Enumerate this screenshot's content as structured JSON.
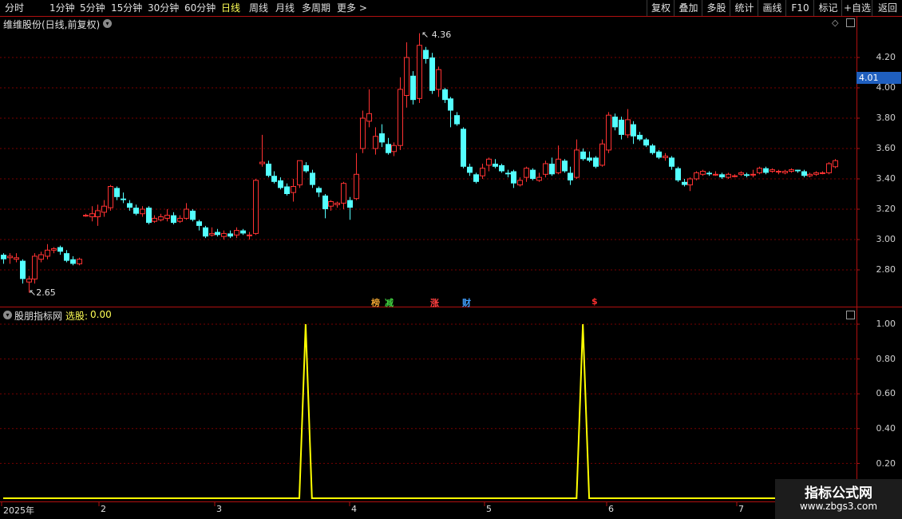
{
  "toolbar": {
    "periods": [
      "分时",
      "1分钟",
      "5分钟",
      "15分钟",
      "30分钟",
      "60分钟",
      "日线",
      "周线",
      "月线",
      "多周期",
      "更多 >"
    ],
    "active_period": "日线",
    "actions": [
      "复权",
      "叠加",
      "多股",
      "统计",
      "画线",
      "F10",
      "标记",
      "+自选",
      "返回"
    ]
  },
  "main_panel": {
    "title": "维维股份(日线,前复权)",
    "current_price": "4.01",
    "high_marker": "4.36",
    "low_marker": "2.65",
    "y_ticks": [
      "4.20",
      "4.00",
      "3.80",
      "3.60",
      "3.40",
      "3.20",
      "3.00",
      "2.80"
    ],
    "tags": [
      {
        "text": "榜",
        "color": "#e8a030"
      },
      {
        "text": "减",
        "color": "#40d040"
      },
      {
        "text": "涨",
        "color": "#ff4040"
      },
      {
        "text": "财",
        "color": "#40a0ff"
      },
      {
        "text": "$",
        "color": "#ff3030"
      }
    ],
    "colors": {
      "up": "#ff3232",
      "down": "#54ffff",
      "grid": "#8b0000"
    }
  },
  "indicator_panel": {
    "title": "股朋指标网",
    "value_label": "选股:",
    "value": "0.00",
    "y_ticks": [
      "1.00",
      "0.80",
      "0.60",
      "0.40",
      "0.20"
    ],
    "line_color": "#ffff00"
  },
  "x_axis": {
    "labels": [
      "2025年",
      "2",
      "3",
      "4",
      "5",
      "6",
      "7"
    ]
  },
  "watermark": {
    "title": "指标公式网",
    "url": "www.zbgs3.com"
  },
  "chart_data": {
    "type": "candlestick",
    "series": [
      {
        "o": 2.9,
        "c": 2.87,
        "h": 2.91,
        "l": 2.84
      },
      {
        "o": 2.88,
        "c": 2.89,
        "h": 2.91,
        "l": 2.84
      },
      {
        "o": 2.87,
        "c": 2.88,
        "h": 2.91,
        "l": 2.85
      },
      {
        "o": 2.86,
        "c": 2.74,
        "h": 2.87,
        "l": 2.71
      },
      {
        "o": 2.72,
        "c": 2.74,
        "h": 2.76,
        "l": 2.65
      },
      {
        "o": 2.74,
        "c": 2.89,
        "h": 2.91,
        "l": 2.71
      },
      {
        "o": 2.87,
        "c": 2.9,
        "h": 2.92,
        "l": 2.85
      },
      {
        "o": 2.89,
        "c": 2.93,
        "h": 2.97,
        "l": 2.87
      },
      {
        "o": 2.93,
        "c": 2.94,
        "h": 2.95,
        "l": 2.91
      },
      {
        "o": 2.95,
        "c": 2.92,
        "h": 2.96,
        "l": 2.9
      },
      {
        "o": 2.91,
        "c": 2.86,
        "h": 2.93,
        "l": 2.85
      },
      {
        "o": 2.87,
        "c": 2.84,
        "h": 2.89,
        "l": 2.83
      },
      {
        "o": 2.84,
        "c": 2.87,
        "h": 2.88,
        "l": 2.83
      },
      {
        "o": 3.16,
        "c": 3.16,
        "h": 3.17,
        "l": 3.15
      },
      {
        "o": 3.15,
        "c": 3.17,
        "h": 3.22,
        "l": 3.12
      },
      {
        "o": 3.15,
        "c": 3.19,
        "h": 3.23,
        "l": 3.09
      },
      {
        "o": 3.18,
        "c": 3.22,
        "h": 3.26,
        "l": 3.15
      },
      {
        "o": 3.21,
        "c": 3.35,
        "h": 3.36,
        "l": 3.19
      },
      {
        "o": 3.34,
        "c": 3.28,
        "h": 3.35,
        "l": 3.26
      },
      {
        "o": 3.27,
        "c": 3.26,
        "h": 3.31,
        "l": 3.24
      },
      {
        "o": 3.24,
        "c": 3.21,
        "h": 3.26,
        "l": 3.19
      },
      {
        "o": 3.21,
        "c": 3.17,
        "h": 3.23,
        "l": 3.16
      },
      {
        "o": 3.17,
        "c": 3.2,
        "h": 3.22,
        "l": 3.15
      },
      {
        "o": 3.21,
        "c": 3.11,
        "h": 3.22,
        "l": 3.1
      },
      {
        "o": 3.12,
        "c": 3.14,
        "h": 3.16,
        "l": 3.11
      },
      {
        "o": 3.13,
        "c": 3.15,
        "h": 3.17,
        "l": 3.12
      },
      {
        "o": 3.14,
        "c": 3.16,
        "h": 3.2,
        "l": 3.12
      },
      {
        "o": 3.16,
        "c": 3.11,
        "h": 3.18,
        "l": 3.1
      },
      {
        "o": 3.12,
        "c": 3.14,
        "h": 3.16,
        "l": 3.11
      },
      {
        "o": 3.14,
        "c": 3.2,
        "h": 3.24,
        "l": 3.13
      },
      {
        "o": 3.19,
        "c": 3.13,
        "h": 3.2,
        "l": 3.12
      },
      {
        "o": 3.12,
        "c": 3.09,
        "h": 3.13,
        "l": 3.06
      },
      {
        "o": 3.08,
        "c": 3.02,
        "h": 3.09,
        "l": 3.01
      },
      {
        "o": 3.03,
        "c": 3.04,
        "h": 3.08,
        "l": 3.02
      },
      {
        "o": 3.05,
        "c": 3.03,
        "h": 3.07,
        "l": 3.02
      },
      {
        "o": 3.02,
        "c": 3.04,
        "h": 3.06,
        "l": 3.0
      },
      {
        "o": 3.04,
        "c": 3.02,
        "h": 3.06,
        "l": 3.01
      },
      {
        "o": 3.03,
        "c": 3.06,
        "h": 3.08,
        "l": 3.01
      },
      {
        "o": 3.06,
        "c": 3.04,
        "h": 3.07,
        "l": 3.03
      },
      {
        "o": 3.03,
        "c": 3.03,
        "h": 3.05,
        "l": 3.0
      },
      {
        "o": 3.04,
        "c": 3.39,
        "h": 3.4,
        "l": 3.03
      },
      {
        "o": 3.5,
        "c": 3.51,
        "h": 3.69,
        "l": 3.48
      },
      {
        "o": 3.5,
        "c": 3.42,
        "h": 3.52,
        "l": 3.41
      },
      {
        "o": 3.42,
        "c": 3.38,
        "h": 3.45,
        "l": 3.37
      },
      {
        "o": 3.39,
        "c": 3.34,
        "h": 3.41,
        "l": 3.33
      },
      {
        "o": 3.35,
        "c": 3.3,
        "h": 3.37,
        "l": 3.29
      },
      {
        "o": 3.31,
        "c": 3.35,
        "h": 3.4,
        "l": 3.25
      },
      {
        "o": 3.36,
        "c": 3.52,
        "h": 3.52,
        "l": 3.34
      },
      {
        "o": 3.49,
        "c": 3.45,
        "h": 3.51,
        "l": 3.44
      },
      {
        "o": 3.44,
        "c": 3.36,
        "h": 3.46,
        "l": 3.34
      },
      {
        "o": 3.34,
        "c": 3.31,
        "h": 3.35,
        "l": 3.28
      },
      {
        "o": 3.29,
        "c": 3.2,
        "h": 3.3,
        "l": 3.14
      },
      {
        "o": 3.22,
        "c": 3.25,
        "h": 3.26,
        "l": 3.19
      },
      {
        "o": 3.23,
        "c": 3.24,
        "h": 3.25,
        "l": 3.21
      },
      {
        "o": 3.24,
        "c": 3.37,
        "h": 3.38,
        "l": 3.2
      },
      {
        "o": 3.26,
        "c": 3.21,
        "h": 3.28,
        "l": 3.13
      },
      {
        "o": 3.27,
        "c": 3.43,
        "h": 3.57,
        "l": 3.26
      },
      {
        "o": 3.6,
        "c": 3.8,
        "h": 3.85,
        "l": 3.57
      },
      {
        "o": 3.78,
        "c": 3.83,
        "h": 3.99,
        "l": 3.74
      },
      {
        "o": 3.6,
        "c": 3.68,
        "h": 3.74,
        "l": 3.56
      },
      {
        "o": 3.7,
        "c": 3.64,
        "h": 3.76,
        "l": 3.61
      },
      {
        "o": 3.63,
        "c": 3.57,
        "h": 3.67,
        "l": 3.56
      },
      {
        "o": 3.58,
        "c": 3.62,
        "h": 3.64,
        "l": 3.55
      },
      {
        "o": 3.62,
        "c": 3.99,
        "h": 4.07,
        "l": 3.59
      },
      {
        "o": 3.95,
        "c": 4.2,
        "h": 4.3,
        "l": 3.87
      },
      {
        "o": 4.08,
        "c": 3.92,
        "h": 4.11,
        "l": 3.89
      },
      {
        "o": 3.93,
        "c": 4.28,
        "h": 4.36,
        "l": 3.9
      },
      {
        "o": 4.25,
        "c": 4.19,
        "h": 4.27,
        "l": 4.16
      },
      {
        "o": 4.2,
        "c": 3.98,
        "h": 4.23,
        "l": 3.96
      },
      {
        "o": 3.99,
        "c": 4.12,
        "h": 4.14,
        "l": 3.94
      },
      {
        "o": 3.99,
        "c": 3.92,
        "h": 4.0,
        "l": 3.9
      },
      {
        "o": 3.93,
        "c": 3.85,
        "h": 3.94,
        "l": 3.74
      },
      {
        "o": 3.82,
        "c": 3.76,
        "h": 3.84,
        "l": 3.75
      },
      {
        "o": 3.73,
        "c": 3.48,
        "h": 3.74,
        "l": 3.47
      },
      {
        "o": 3.48,
        "c": 3.44,
        "h": 3.5,
        "l": 3.42
      },
      {
        "o": 3.43,
        "c": 3.38,
        "h": 3.44,
        "l": 3.37
      },
      {
        "o": 3.42,
        "c": 3.47,
        "h": 3.5,
        "l": 3.4
      },
      {
        "o": 3.49,
        "c": 3.53,
        "h": 3.54,
        "l": 3.45
      },
      {
        "o": 3.5,
        "c": 3.48,
        "h": 3.53,
        "l": 3.47
      },
      {
        "o": 3.49,
        "c": 3.45,
        "h": 3.5,
        "l": 3.44
      },
      {
        "o": 3.44,
        "c": 3.43,
        "h": 3.46,
        "l": 3.41
      },
      {
        "o": 3.45,
        "c": 3.37,
        "h": 3.46,
        "l": 3.34
      },
      {
        "o": 3.36,
        "c": 3.39,
        "h": 3.41,
        "l": 3.35
      },
      {
        "o": 3.41,
        "c": 3.47,
        "h": 3.48,
        "l": 3.38
      },
      {
        "o": 3.46,
        "c": 3.4,
        "h": 3.47,
        "l": 3.39
      },
      {
        "o": 3.39,
        "c": 3.41,
        "h": 3.44,
        "l": 3.38
      },
      {
        "o": 3.43,
        "c": 3.5,
        "h": 3.52,
        "l": 3.41
      },
      {
        "o": 3.5,
        "c": 3.43,
        "h": 3.54,
        "l": 3.42
      },
      {
        "o": 3.44,
        "c": 3.53,
        "h": 3.62,
        "l": 3.43
      },
      {
        "o": 3.52,
        "c": 3.45,
        "h": 3.53,
        "l": 3.44
      },
      {
        "o": 3.44,
        "c": 3.39,
        "h": 3.48,
        "l": 3.36
      },
      {
        "o": 3.41,
        "c": 3.59,
        "h": 3.66,
        "l": 3.4
      },
      {
        "o": 3.58,
        "c": 3.53,
        "h": 3.6,
        "l": 3.52
      },
      {
        "o": 3.54,
        "c": 3.52,
        "h": 3.58,
        "l": 3.51
      },
      {
        "o": 3.54,
        "c": 3.48,
        "h": 3.55,
        "l": 3.47
      },
      {
        "o": 3.49,
        "c": 3.63,
        "h": 3.66,
        "l": 3.48
      },
      {
        "o": 3.59,
        "c": 3.82,
        "h": 3.84,
        "l": 3.57
      },
      {
        "o": 3.81,
        "c": 3.74,
        "h": 3.83,
        "l": 3.72
      },
      {
        "o": 3.79,
        "c": 3.69,
        "h": 3.81,
        "l": 3.66
      },
      {
        "o": 3.69,
        "c": 3.79,
        "h": 3.86,
        "l": 3.67
      },
      {
        "o": 3.76,
        "c": 3.68,
        "h": 3.78,
        "l": 3.63
      },
      {
        "o": 3.69,
        "c": 3.66,
        "h": 3.71,
        "l": 3.65
      },
      {
        "o": 3.66,
        "c": 3.62,
        "h": 3.67,
        "l": 3.61
      },
      {
        "o": 3.62,
        "c": 3.57,
        "h": 3.63,
        "l": 3.56
      },
      {
        "o": 3.58,
        "c": 3.54,
        "h": 3.59,
        "l": 3.53
      },
      {
        "o": 3.54,
        "c": 3.55,
        "h": 3.57,
        "l": 3.52
      },
      {
        "o": 3.54,
        "c": 3.48,
        "h": 3.55,
        "l": 3.46
      },
      {
        "o": 3.47,
        "c": 3.39,
        "h": 3.48,
        "l": 3.38
      },
      {
        "o": 3.38,
        "c": 3.36,
        "h": 3.4,
        "l": 3.35
      },
      {
        "o": 3.36,
        "c": 3.4,
        "h": 3.41,
        "l": 3.32
      },
      {
        "o": 3.4,
        "c": 3.44,
        "h": 3.45,
        "l": 3.39
      },
      {
        "o": 3.43,
        "c": 3.45,
        "h": 3.46,
        "l": 3.42
      },
      {
        "o": 3.44,
        "c": 3.43,
        "h": 3.45,
        "l": 3.42
      },
      {
        "o": 3.43,
        "c": 3.43,
        "h": 3.45,
        "l": 3.42
      },
      {
        "o": 3.43,
        "c": 3.41,
        "h": 3.44,
        "l": 3.4
      },
      {
        "o": 3.41,
        "c": 3.43,
        "h": 3.44,
        "l": 3.4
      },
      {
        "o": 3.42,
        "c": 3.42,
        "h": 3.43,
        "l": 3.41
      },
      {
        "o": 3.43,
        "c": 3.44,
        "h": 3.45,
        "l": 3.42
      },
      {
        "o": 3.43,
        "c": 3.42,
        "h": 3.44,
        "l": 3.41
      },
      {
        "o": 3.43,
        "c": 3.43,
        "h": 3.46,
        "l": 3.41
      },
      {
        "o": 3.44,
        "c": 3.47,
        "h": 3.48,
        "l": 3.43
      },
      {
        "o": 3.47,
        "c": 3.44,
        "h": 3.48,
        "l": 3.43
      },
      {
        "o": 3.45,
        "c": 3.46,
        "h": 3.47,
        "l": 3.44
      },
      {
        "o": 3.45,
        "c": 3.45,
        "h": 3.46,
        "l": 3.43
      },
      {
        "o": 3.44,
        "c": 3.45,
        "h": 3.46,
        "l": 3.43
      },
      {
        "o": 3.45,
        "c": 3.46,
        "h": 3.47,
        "l": 3.44
      },
      {
        "o": 3.46,
        "c": 3.45,
        "h": 3.46,
        "l": 3.44
      },
      {
        "o": 3.45,
        "c": 3.42,
        "h": 3.46,
        "l": 3.41
      },
      {
        "o": 3.42,
        "c": 3.43,
        "h": 3.44,
        "l": 3.41
      },
      {
        "o": 3.43,
        "c": 3.44,
        "h": 3.45,
        "l": 3.42
      },
      {
        "o": 3.44,
        "c": 3.44,
        "h": 3.45,
        "l": 3.43
      },
      {
        "o": 3.44,
        "c": 3.5,
        "h": 3.51,
        "l": 3.43
      },
      {
        "o": 3.48,
        "c": 3.52,
        "h": 3.53,
        "l": 3.47
      }
    ],
    "indicator_values": [
      0,
      0,
      0,
      0,
      0,
      0,
      0,
      0,
      0,
      0,
      0,
      0,
      0,
      0,
      0,
      0,
      0,
      0,
      0,
      0,
      0,
      0,
      0,
      0,
      0,
      0,
      0,
      0,
      0,
      0,
      0,
      0,
      0,
      0,
      0,
      0,
      0,
      0,
      0,
      0,
      0,
      0,
      0,
      0,
      0,
      0,
      0,
      0,
      0,
      0,
      0,
      0,
      0,
      0,
      0,
      0,
      0,
      0,
      0,
      0,
      0,
      0,
      0,
      0,
      0,
      0,
      0,
      0,
      0,
      0,
      0,
      0,
      0,
      0,
      0,
      0,
      0,
      0,
      0,
      0,
      0,
      0,
      0,
      0,
      0,
      0,
      0,
      0,
      0,
      0,
      0,
      0,
      0,
      0,
      0,
      0,
      0,
      0,
      0,
      0,
      0,
      0,
      0,
      0,
      0,
      0,
      0,
      0,
      0,
      0,
      0,
      0,
      0,
      0,
      0,
      0,
      0,
      0,
      0,
      0,
      0,
      0,
      0,
      0,
      0,
      0,
      0,
      0,
      0,
      0
    ],
    "indicator_spikes": [
      {
        "index": 48,
        "value": 1.0
      },
      {
        "index": 92,
        "value": 1.0
      }
    ],
    "indicator_ylim": [
      0,
      1.05
    ]
  }
}
